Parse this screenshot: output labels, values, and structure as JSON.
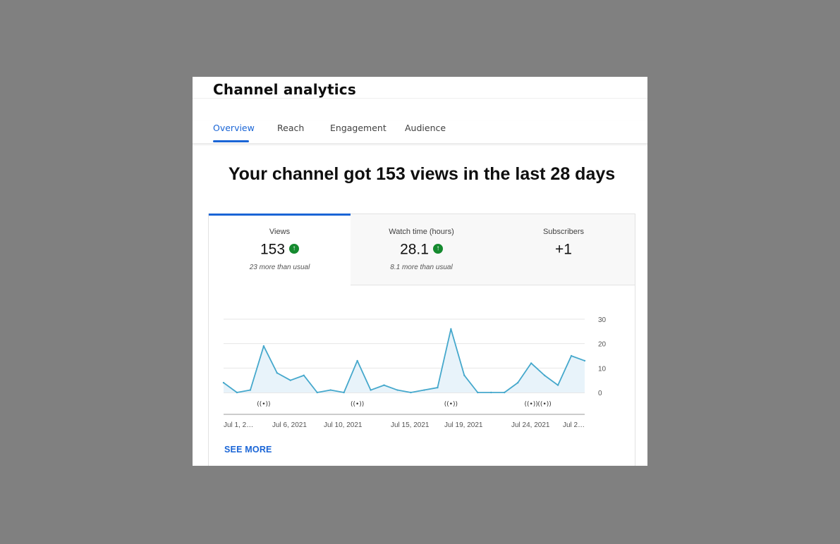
{
  "page": {
    "title": "Channel analytics",
    "headline": "Your channel got 153 views in the last 28 days"
  },
  "tabs": [
    {
      "label": "Overview",
      "active": true
    },
    {
      "label": "Reach",
      "active": false
    },
    {
      "label": "Engagement",
      "active": false
    },
    {
      "label": "Audience",
      "active": false
    }
  ],
  "metrics": [
    {
      "label": "Views",
      "value": "153",
      "trend": "up",
      "sub": "23 more than usual",
      "active": true
    },
    {
      "label": "Watch time (hours)",
      "value": "28.1",
      "trend": "up",
      "sub": "8.1 more than usual",
      "active": false
    },
    {
      "label": "Subscribers",
      "value": "+1",
      "trend": "",
      "sub": "",
      "active": false
    }
  ],
  "colors": {
    "accent": "#1a65d6",
    "line": "#45a8cc",
    "area": "#e8f3fa",
    "trend_up": "#158a2f"
  },
  "see_more": "SEE MORE",
  "chart_data": {
    "type": "area",
    "series": [
      {
        "values": [
          4,
          0,
          1,
          19,
          8,
          5,
          7,
          0,
          1,
          0,
          13,
          1,
          3,
          1,
          0,
          1,
          2,
          26,
          7,
          0,
          0,
          0,
          4,
          12,
          7,
          3,
          15,
          13
        ]
      }
    ],
    "x_tick_labels": [
      "Jul 1, 2…",
      "Jul 6, 2021",
      "Jul 10, 2021",
      "Jul 15, 2021",
      "Jul 19, 2021",
      "Jul 24, 2021",
      "Jul 2…"
    ],
    "y_ticks": [
      0,
      10,
      20,
      30
    ],
    "ylim": [
      0,
      30
    ],
    "grid": true,
    "marker_icon": "live-stream-icon",
    "marker_symbol": "((•))",
    "markers_at_day_index": [
      3,
      10,
      17,
      23,
      24
    ]
  }
}
